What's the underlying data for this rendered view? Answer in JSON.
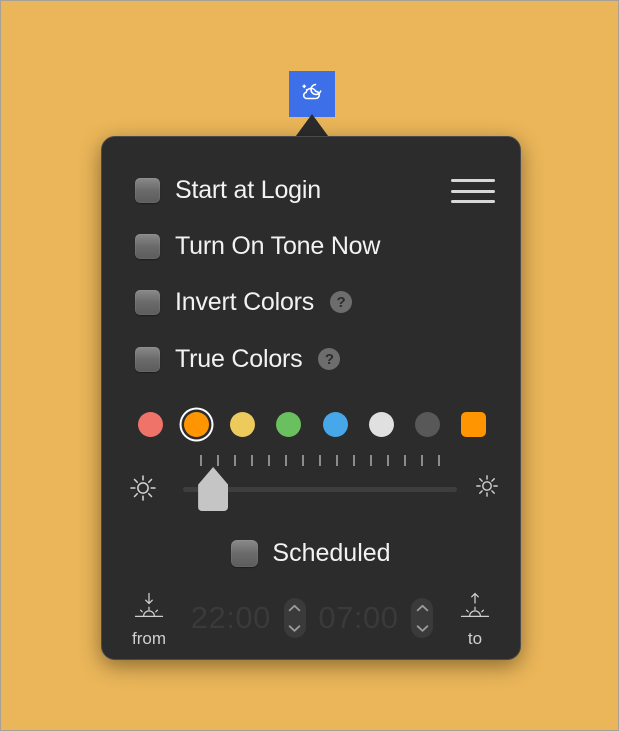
{
  "app": {
    "menubar_icon_name": "cloud-moon-stars-icon",
    "menubar_icon_bg": "#3d6fe8",
    "desktop_bg": "#ebb659",
    "panel_bg": "#2c2c2c"
  },
  "panel": {
    "menu_button_label": "menu",
    "options": [
      {
        "label": "Start at Login",
        "checked": false,
        "help": null
      },
      {
        "label": "Turn On Tone Now",
        "checked": false,
        "help": null
      },
      {
        "label": "Invert Colors",
        "checked": false,
        "help": "?"
      },
      {
        "label": "True Colors",
        "checked": false,
        "help": "?"
      }
    ],
    "swatches": [
      {
        "name": "red",
        "color": "#f0736a",
        "shape": "circle",
        "selected": false
      },
      {
        "name": "orange",
        "color": "#ff9500",
        "shape": "circle",
        "selected": true
      },
      {
        "name": "yellow",
        "color": "#eccb5c",
        "shape": "circle",
        "selected": false
      },
      {
        "name": "green",
        "color": "#6abf5e",
        "shape": "circle",
        "selected": false
      },
      {
        "name": "blue",
        "color": "#46a8e8",
        "shape": "circle",
        "selected": false
      },
      {
        "name": "white",
        "color": "#e0e0e0",
        "shape": "circle",
        "selected": false
      },
      {
        "name": "gray",
        "color": "#585858",
        "shape": "circle",
        "selected": false
      },
      {
        "name": "custom",
        "color": "#ff9500",
        "shape": "square",
        "selected": false
      }
    ],
    "slider": {
      "name": "intensity-slider",
      "tick_count": 15,
      "value_percent": 11,
      "low_icon": "sun-small-icon",
      "high_icon": "sun-large-icon"
    },
    "scheduled": {
      "label": "Scheduled",
      "checked": false,
      "from": {
        "caption": "from",
        "time": "22:00",
        "icon": "sunset-icon",
        "enabled": false
      },
      "to": {
        "caption": "to",
        "time": "07:00",
        "icon": "sunrise-icon",
        "enabled": false
      },
      "stepper_icon": "chevron-up-down-icon"
    }
  }
}
